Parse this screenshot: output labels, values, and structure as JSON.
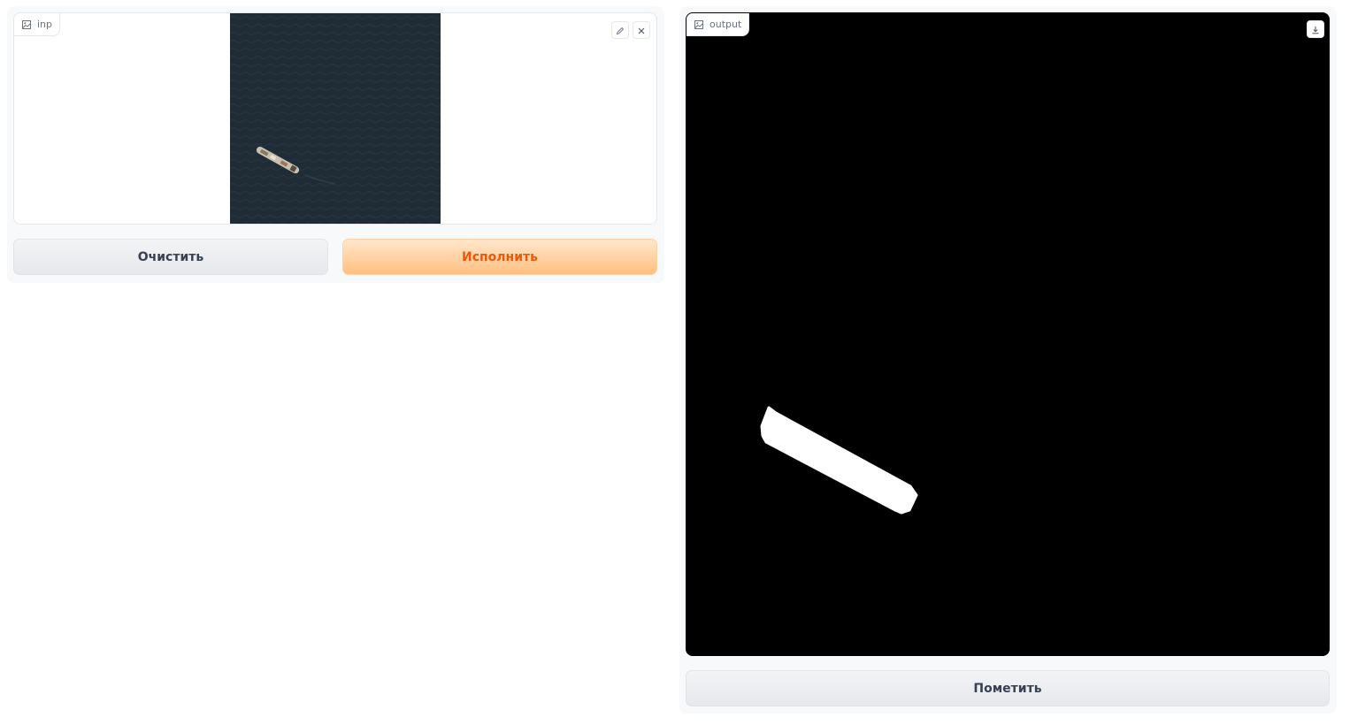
{
  "input": {
    "label": "inp",
    "icon": "image-icon",
    "actions": [
      "pencil-icon",
      "close-icon"
    ]
  },
  "output": {
    "label": "output",
    "icon": "image-icon",
    "actions": [
      "download-icon"
    ]
  },
  "buttons": {
    "clear": "Очистить",
    "run": "Исполнить",
    "flag": "Пометить"
  },
  "colors": {
    "accent": "#ea580c",
    "primary_button": "#ffbf80",
    "secondary_button": "#e6e8ec"
  }
}
